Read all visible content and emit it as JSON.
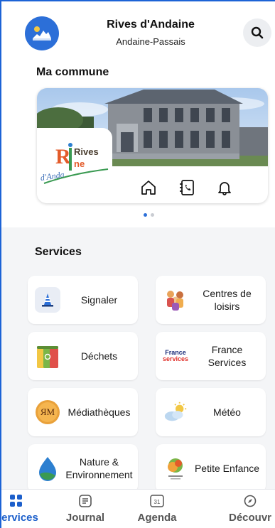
{
  "header": {
    "title": "Rives d'Andaine",
    "subtitle": "Andaine-Passais"
  },
  "commune": {
    "section_title": "Ma commune",
    "logo_text": {
      "line1": "Rives",
      "line2": "ne",
      "line3": "d'Anda"
    },
    "quick_icons": [
      "home-icon",
      "phone-contact-icon",
      "bell-icon"
    ],
    "carousel_pages": 2,
    "carousel_active": 1
  },
  "services": {
    "section_title": "Services",
    "items": [
      {
        "label": "Signaler",
        "icon": "traffic-cone-icon"
      },
      {
        "label": "Centres de loisirs",
        "icon": "children-icon"
      },
      {
        "label": "Déchets",
        "icon": "bins-icon"
      },
      {
        "label": "France Services",
        "icon": "france-services-icon",
        "icon_text": "France services"
      },
      {
        "label": "Médiathèques",
        "icon": "mediatheque-icon",
        "icon_text": "ЯМ"
      },
      {
        "label": "Météo",
        "icon": "weather-icon"
      },
      {
        "label": "Nature & Environnement",
        "icon": "nature-icon"
      },
      {
        "label": "Petite Enfance",
        "icon": "petite-enfance-icon"
      }
    ]
  },
  "bottom_nav": {
    "items": [
      {
        "label": "Services",
        "icon": "grid-icon",
        "active": true
      },
      {
        "label": "Journal",
        "icon": "journal-icon",
        "active": false
      },
      {
        "label": "Agenda",
        "icon": "calendar-icon",
        "icon_text": "31",
        "active": false
      },
      {
        "label": "Découvr",
        "icon": "compass-icon",
        "active": false
      }
    ]
  },
  "colors": {
    "accent": "#1c5fcb",
    "background": "#f4f5f7"
  }
}
